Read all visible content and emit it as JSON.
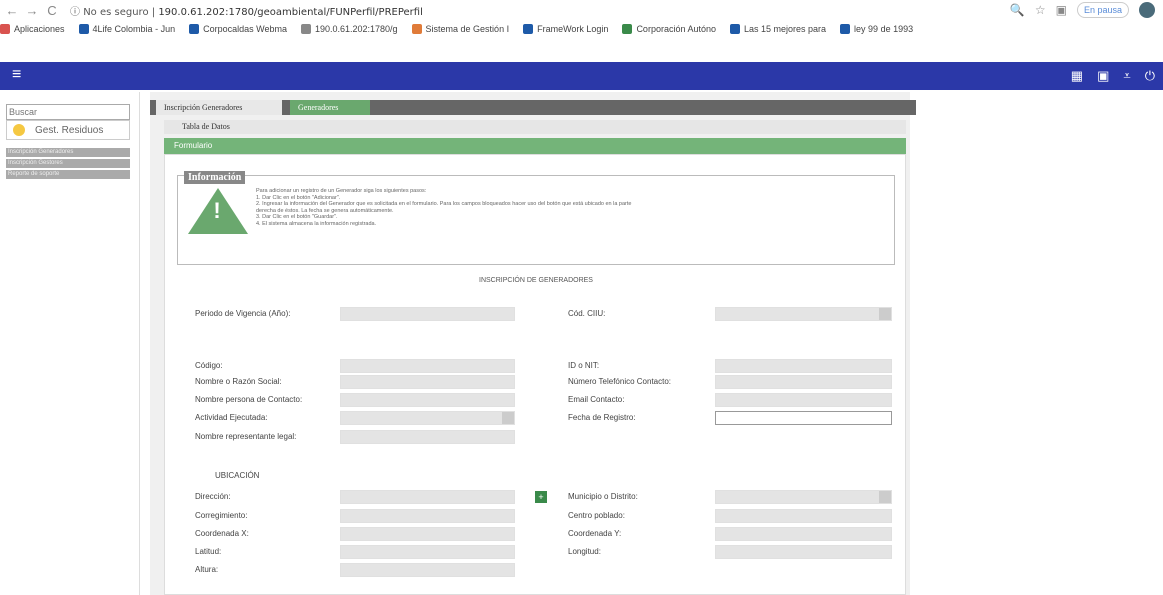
{
  "browser": {
    "insecure_label": "No es seguro",
    "url": "190.0.61.202:1780/geoambiental/FUNPerfil/PREPerfil",
    "paused_label": "En pausa"
  },
  "bookmarks": [
    {
      "label": "Aplicaciones",
      "color": "#d9534f"
    },
    {
      "label": "4Life Colombia - Jun",
      "color": "#1e5aa8"
    },
    {
      "label": "Corpocaldas Webma",
      "color": "#1e5aa8"
    },
    {
      "label": "190.0.61.202:1780/g",
      "color": "#888888"
    },
    {
      "label": "Sistema de Gestión I",
      "color": "#e07b39"
    },
    {
      "label": "FrameWork Login",
      "color": "#1e5aa8"
    },
    {
      "label": "Corporación Autóno",
      "color": "#3a8a4a"
    },
    {
      "label": "Las 15 mejores para",
      "color": "#1e5aa8"
    },
    {
      "label": "ley 99 de 1993",
      "color": "#1e5aa8"
    }
  ],
  "sidebar": {
    "search_placeholder": "Buscar",
    "section": "Gest. Residuos",
    "items": [
      "Inscripción Generadores",
      "Inscripción Gestores",
      "Reporte de soporte"
    ]
  },
  "tabs": {
    "tab1": "Inscripción Generadores",
    "tab2": "Generadores"
  },
  "panels": {
    "tabla": "Tabla de Datos",
    "formulario": "Formulario"
  },
  "info": {
    "title": "Información",
    "lines": [
      "Para adicionar un registro de un Generador siga los siguientes pasos:",
      "1. Dar Clic en el botón \"Adicionar\".",
      "2. Ingresar la información del Generador que es solicitada en el formulario. Para los campos bloqueados hacer uso del botón que está ubicado en la parte",
      "derecha de éstos. La fecha se genera automáticamente.",
      "3. Dar Clic en el botón \"Guardar\".",
      "4. El sistema almacena la información registrada."
    ]
  },
  "form": {
    "title": "INSCRIPCIÓN DE GENERADORES",
    "periodo": "Periodo de Vigencia (Año):",
    "ciiu": "Cód. CIIU:",
    "codigo": "Código:",
    "nit": "ID o NIT:",
    "nombre": "Nombre o Razón Social:",
    "telefono": "Número Telefónico Contacto:",
    "contacto": "Nombre persona de Contacto:",
    "email": "Email Contacto:",
    "actividad": "Actividad Ejecutada:",
    "fecha": "Fecha de Registro:",
    "representante": "Nombre representante legal:",
    "ubicacion": "UBICACIÓN",
    "direccion": "Dirección:",
    "municipio": "Municipio o Distrito:",
    "corregimiento": "Corregimiento:",
    "centro": "Centro poblado:",
    "coordx": "Coordenada X:",
    "coordy": "Coordenada Y:",
    "latitud": "Latitud:",
    "longitud": "Longitud:",
    "altura": "Altura:"
  }
}
